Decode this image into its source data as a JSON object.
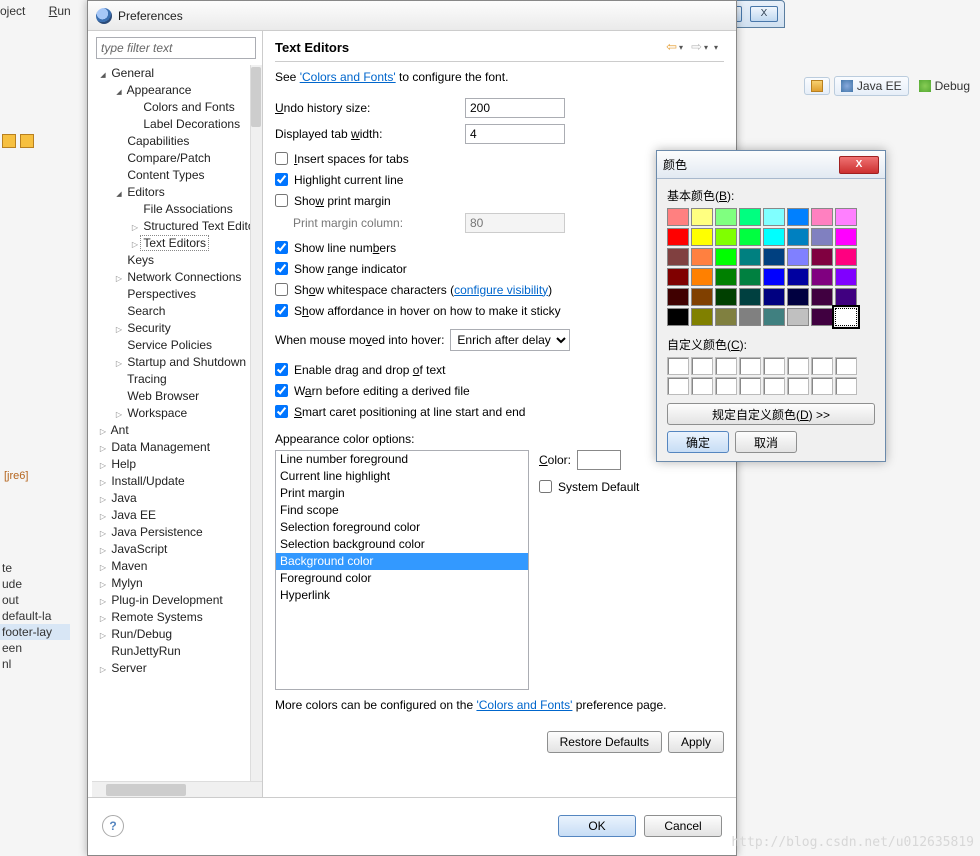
{
  "bg_menu": [
    "oject",
    "Run"
  ],
  "dialog": {
    "title": "Preferences"
  },
  "filter": {
    "placeholder": "type filter text"
  },
  "tree": [
    {
      "ind": 0,
      "a": "open",
      "t": "General"
    },
    {
      "ind": 1,
      "a": "open",
      "t": "Appearance"
    },
    {
      "ind": 2,
      "a": "none",
      "t": "Colors and Fonts"
    },
    {
      "ind": 2,
      "a": "none",
      "t": "Label Decorations"
    },
    {
      "ind": 1,
      "a": "none",
      "t": "Capabilities"
    },
    {
      "ind": 1,
      "a": "none",
      "t": "Compare/Patch"
    },
    {
      "ind": 1,
      "a": "none",
      "t": "Content Types"
    },
    {
      "ind": 1,
      "a": "open",
      "t": "Editors"
    },
    {
      "ind": 2,
      "a": "none",
      "t": "File Associations"
    },
    {
      "ind": 2,
      "a": "closed",
      "t": "Structured Text Editors"
    },
    {
      "ind": 2,
      "a": "closed",
      "t": "Text Editors",
      "sel": true
    },
    {
      "ind": 1,
      "a": "none",
      "t": "Keys"
    },
    {
      "ind": 1,
      "a": "closed",
      "t": "Network Connections"
    },
    {
      "ind": 1,
      "a": "none",
      "t": "Perspectives"
    },
    {
      "ind": 1,
      "a": "none",
      "t": "Search"
    },
    {
      "ind": 1,
      "a": "closed",
      "t": "Security"
    },
    {
      "ind": 1,
      "a": "none",
      "t": "Service Policies"
    },
    {
      "ind": 1,
      "a": "closed",
      "t": "Startup and Shutdown"
    },
    {
      "ind": 1,
      "a": "none",
      "t": "Tracing"
    },
    {
      "ind": 1,
      "a": "none",
      "t": "Web Browser"
    },
    {
      "ind": 1,
      "a": "closed",
      "t": "Workspace"
    },
    {
      "ind": 0,
      "a": "closed",
      "t": "Ant"
    },
    {
      "ind": 0,
      "a": "closed",
      "t": "Data Management"
    },
    {
      "ind": 0,
      "a": "closed",
      "t": "Help"
    },
    {
      "ind": 0,
      "a": "closed",
      "t": "Install/Update"
    },
    {
      "ind": 0,
      "a": "closed",
      "t": "Java"
    },
    {
      "ind": 0,
      "a": "closed",
      "t": "Java EE"
    },
    {
      "ind": 0,
      "a": "closed",
      "t": "Java Persistence"
    },
    {
      "ind": 0,
      "a": "closed",
      "t": "JavaScript"
    },
    {
      "ind": 0,
      "a": "closed",
      "t": "Maven"
    },
    {
      "ind": 0,
      "a": "closed",
      "t": "Mylyn"
    },
    {
      "ind": 0,
      "a": "closed",
      "t": "Plug-in Development"
    },
    {
      "ind": 0,
      "a": "closed",
      "t": "Remote Systems"
    },
    {
      "ind": 0,
      "a": "closed",
      "t": "Run/Debug"
    },
    {
      "ind": 0,
      "a": "none",
      "t": "RunJettyRun"
    },
    {
      "ind": 0,
      "a": "closed",
      "t": "Server"
    }
  ],
  "page": {
    "title": "Text Editors",
    "desc_pre": "See ",
    "desc_link": "'Colors and Fonts'",
    "desc_post": " to configure the font.",
    "undo_label": "Undo history size:",
    "undo_val": "200",
    "tab_label": "Displayed tab width:",
    "tab_val": "4",
    "insert_spaces": "Insert spaces for tabs",
    "highlight": "Highlight current line",
    "print_margin": "Show print margin",
    "print_col_label": "Print margin column:",
    "print_col_val": "80",
    "line_nums": "Show line numbers",
    "range_ind": "Show range indicator",
    "whitespace_pre": "Show whitespace characters (",
    "whitespace_link": "configure visibility",
    "whitespace_post": ")",
    "affordance": "Show affordance in hover on how to make it sticky",
    "hover_label": "When mouse moved into hover:",
    "hover_opt": "Enrich after delay",
    "drag": "Enable drag and drop of text",
    "warn": "Warn before editing a derived file",
    "smart": "Smart caret positioning at line start and end",
    "color_lbl": "Appearance color options:",
    "color_label2": "Color:",
    "sys_default": "System Default",
    "options": [
      "Line number foreground",
      "Current line highlight",
      "Print margin",
      "Find scope",
      "Selection foreground color",
      "Selection background color",
      "Background color",
      "Foreground color",
      "Hyperlink"
    ],
    "more_pre": "More colors can be configured on the ",
    "more_link": "'Colors and Fonts'",
    "more_post": " preference page.",
    "restore": "Restore Defaults",
    "apply": "Apply",
    "ok": "OK",
    "cancel": "Cancel"
  },
  "cp": {
    "title": "颜色",
    "basic": "基本颜色(B):",
    "custom": "自定义颜色(C):",
    "define": "规定自定义颜色(D) >>",
    "ok": "确定",
    "cancel": "取消",
    "colors": [
      "#ff8080",
      "#ffff80",
      "#80ff80",
      "#00ff80",
      "#80ffff",
      "#0080ff",
      "#ff80c0",
      "#ff80ff",
      "#ff0000",
      "#ffff00",
      "#80ff00",
      "#00ff40",
      "#00ffff",
      "#0080c0",
      "#8080c0",
      "#ff00ff",
      "#804040",
      "#ff8040",
      "#00ff00",
      "#008080",
      "#004080",
      "#8080ff",
      "#800040",
      "#ff0080",
      "#800000",
      "#ff8000",
      "#008000",
      "#008040",
      "#0000ff",
      "#0000a0",
      "#800080",
      "#8000ff",
      "#400000",
      "#804000",
      "#004000",
      "#004040",
      "#000080",
      "#000040",
      "#400040",
      "#400080",
      "#000000",
      "#808000",
      "#808040",
      "#808080",
      "#408080",
      "#c0c0c0",
      "#400040",
      "#ffffff"
    ]
  },
  "persp": {
    "javaee": "Java EE",
    "debug": "Debug"
  },
  "bgleft": {
    "jre": "[jre6]"
  },
  "bgpanel2": [
    "te",
    "ude",
    "out",
    "default-la",
    "footer-lay",
    "een",
    "nl"
  ],
  "watermark": "http://blog.csdn.net/u012635819"
}
